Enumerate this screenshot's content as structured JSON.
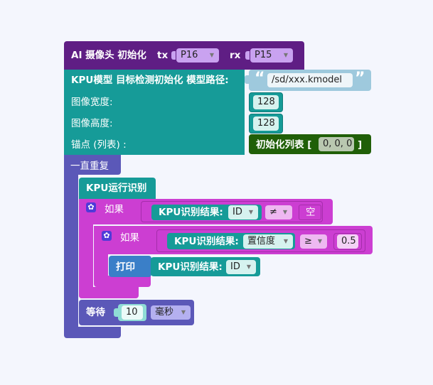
{
  "colors": {
    "background": "#f4f6fd",
    "ai_camera": "#5f1e84",
    "kpu": "#169b98",
    "loop": "#5b58b8",
    "logic": "#cc3ed2",
    "print": "#3a7fc8",
    "list": "#205f08"
  },
  "camera_init": {
    "label": "AI 摄像头 初始化",
    "tx_label": "tx",
    "tx_value": "P16",
    "rx_label": "rx",
    "rx_value": "P15"
  },
  "kpu_init": {
    "label": "KPU模型 目标检测初始化 模型路径:",
    "path_value": "/sd/xxx.kmodel",
    "width_label": "图像宽度:",
    "width_value": "128",
    "height_label": "图像高度:",
    "height_value": "128",
    "anchor_label": "锚点 (列表) :",
    "list_init_label": "初始化列表 [",
    "list_value": "0, 0, 0",
    "list_close": "]"
  },
  "loop": {
    "label": "一直重复"
  },
  "kpu_run": {
    "label": "KPU运行识别"
  },
  "if_outer": {
    "label": "如果",
    "result_label": "KPU识别结果:",
    "field": "ID",
    "operator": "≠",
    "value": "空"
  },
  "if_inner": {
    "label": "如果",
    "result_label": "KPU识别结果:",
    "field": "置信度",
    "operator": "≥",
    "value": "0.5"
  },
  "print_block": {
    "label": "打印",
    "result_label": "KPU识别结果:",
    "field": "ID"
  },
  "wait": {
    "label": "等待",
    "value": "10",
    "unit": "毫秒"
  }
}
